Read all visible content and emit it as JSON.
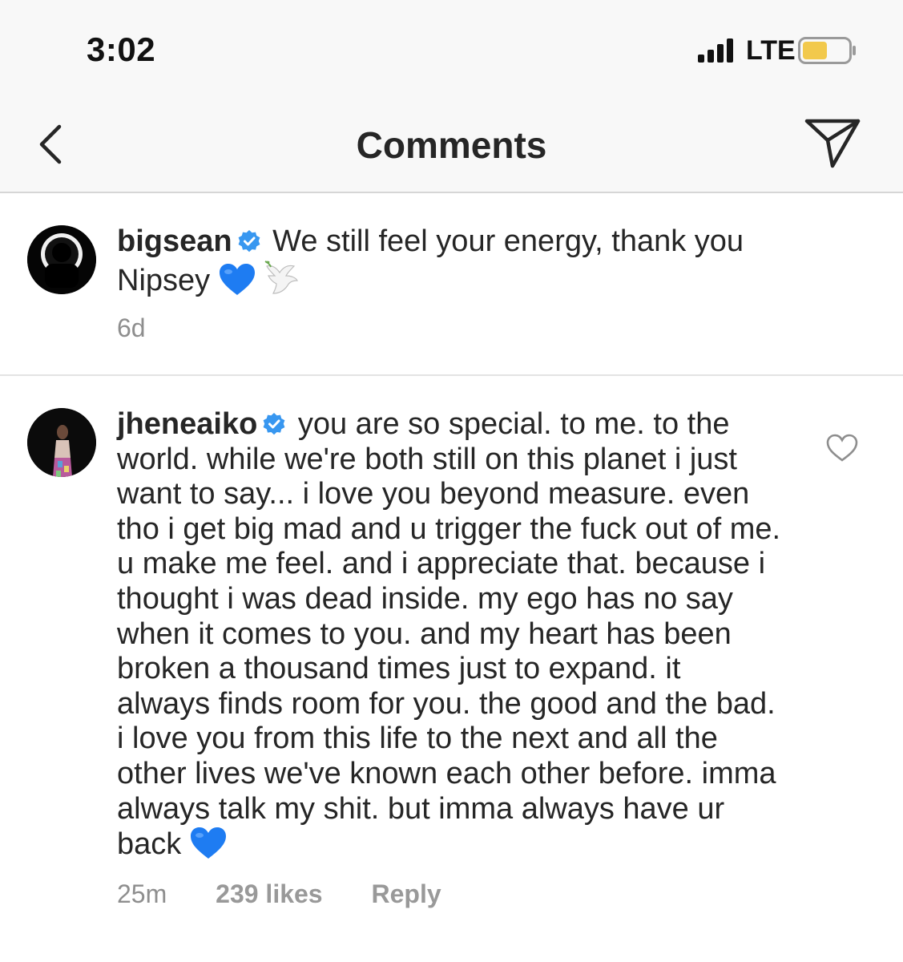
{
  "status_bar": {
    "time": "3:02",
    "network": "LTE",
    "battery_color": "#f2c94c",
    "signal_icon": "signal-bars-icon",
    "battery_icon": "battery-icon"
  },
  "nav": {
    "title": "Comments",
    "back_icon": "chevron-left-icon",
    "send_icon": "paper-plane-icon"
  },
  "comments": [
    {
      "username": "bigsean",
      "verified": true,
      "text": "We still feel your energy, thank you Nipsey",
      "emojis": "blue-heart, dove-of-peace",
      "time": "6d"
    },
    {
      "username": "jheneaiko",
      "verified": true,
      "text": "you are so special. to me. to the world. while we're both still on this planet i just want to say... i love you beyond measure. even tho i get big mad and u trigger the fuck out of me. u make me feel. and i appreciate that. because i thought i was dead inside. my ego has no say when it comes to you. and my heart has been broken a thousand times just to expand. it always finds room for you. the good and the bad. i love you from this life to the next and all the other lives we've known each other before. imma always talk my shit. but imma always have ur back",
      "emojis": "blue-heart",
      "time": "25m",
      "likes": "239 likes",
      "reply_label": "Reply"
    }
  ],
  "colors": {
    "verified_blue": "#3897f0",
    "heart_blue": "#1e7cf2",
    "meta_gray": "#8e8e8e"
  }
}
